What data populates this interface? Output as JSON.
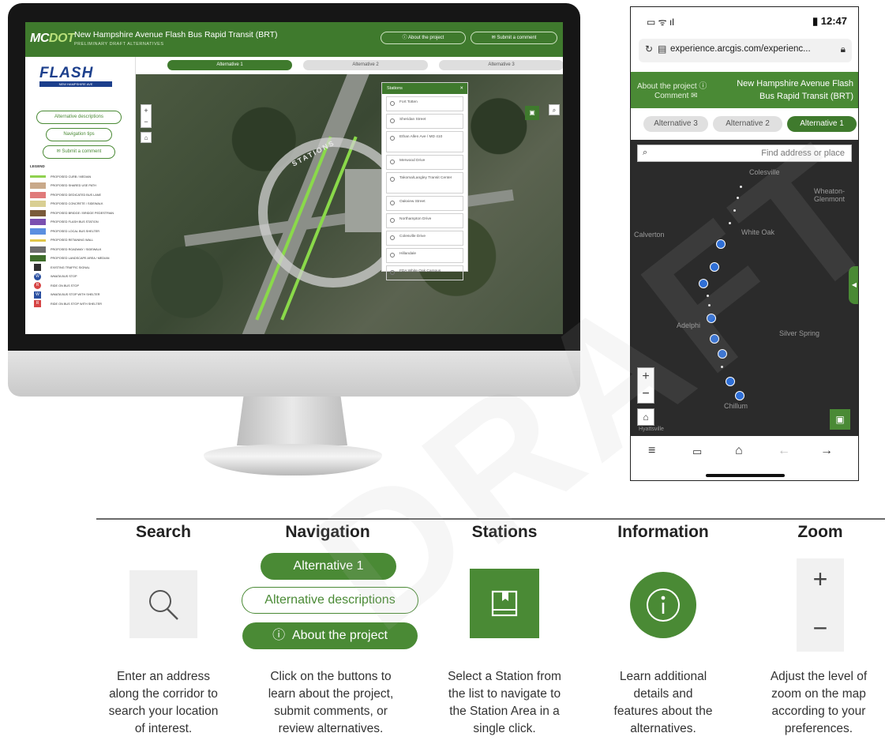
{
  "desktop": {
    "logo": {
      "main": "MC",
      "accent": "DOT"
    },
    "title": "New Hampshire Avenue Flash Bus Rapid Transit (BRT)",
    "subtitle": "PRELIMINARY DRAFT ALTERNATIVES",
    "header_buttons": [
      "About the project",
      "Submit a comment"
    ],
    "flash_logo": "FLASH",
    "flash_tag": "NEW HAMPSHIRE AVE",
    "left_buttons": [
      "Alternative descriptions",
      "Navigation tips",
      "Submit a comment"
    ],
    "legend_title": "LEGEND",
    "legend": [
      {
        "label": "PROPOSED CURB / MEDIAN",
        "color": "#8fd14f",
        "kind": "line"
      },
      {
        "label": "PROPOSED SHARED USE PATH",
        "color": "#c9a98a",
        "kind": "box"
      },
      {
        "label": "PROPOSED DEDICATED BUS LANE",
        "color": "#e07a7a",
        "kind": "box"
      },
      {
        "label": "PROPOSED CONCRETE / SIDEWALK",
        "color": "#d9cf93",
        "kind": "box"
      },
      {
        "label": "PROPOSED BRIDGE / BRIDGE PEDESTRIAN",
        "color": "#7a5a3a",
        "kind": "box"
      },
      {
        "label": "PROPOSED FLASH BUS STATION",
        "color": "#7a4fb0",
        "kind": "box"
      },
      {
        "label": "PROPOSED LOCAL BUS SHELTER",
        "color": "#5b8fe0",
        "kind": "box"
      },
      {
        "label": "PROPOSED RETAINING WALL",
        "color": "#e0c64a",
        "kind": "line"
      },
      {
        "label": "PROPOSED ROADWAY / SIDEWALK",
        "color": "#6d6d6d",
        "kind": "box"
      },
      {
        "label": "PROPOSED LANDSCAPE AREA / MEDIAN",
        "color": "#3f6e2c",
        "kind": "box"
      },
      {
        "label": "EXISTING TRAFFIC SIGNAL",
        "color": "#2f2f2f",
        "kind": "sq"
      },
      {
        "label": "WMATA BUS STOP",
        "color": "#2a4fa0",
        "kind": "circle",
        "glyph": "W"
      },
      {
        "label": "RIDE ON BUS STOP",
        "color": "#d64545",
        "kind": "circle",
        "glyph": "R"
      },
      {
        "label": "WMATA BUS STOP WITH SHELTER",
        "color": "#2a4fa0",
        "kind": "sq",
        "glyph": "W"
      },
      {
        "label": "RIDE ON BUS STOP WITH SHELTER",
        "color": "#d64545",
        "kind": "sq",
        "glyph": "R"
      }
    ],
    "tabs": [
      "Alternative 1",
      "Alternative 2",
      "Alternative 3"
    ],
    "map_ring_text": "STATIONS",
    "stations_title": "Stations",
    "stations": [
      "Fort Totten",
      "Sheridan Street",
      "Ethan Allen Ave / MD 410",
      "Merwood Drive",
      "Takoma/Langley Transit Center",
      "Oakview Street",
      "Northampton Drive",
      "Colesville Drive",
      "Hillandale",
      "FDA White Oak Campus"
    ]
  },
  "mobile": {
    "time": "12:47",
    "signal": "▮",
    "url": "experience.arcgis.com/experienc...",
    "title_line1": "New Hampshire Avenue Flash",
    "title_line2": "Bus Rapid Transit (BRT)",
    "about": "About the project",
    "comment": "Comment",
    "tabs": [
      "Alternative 1",
      "Alternative 2",
      "Alternative 3"
    ],
    "search_placeholder": "Find address or place",
    "places": [
      "Colesville",
      "Wheaton-Glenmont",
      "White Oak",
      "Calverton",
      "Adelphi",
      "Silver Spring",
      "Chillum",
      "Hyattsville"
    ]
  },
  "legend_panel": {
    "columns": [
      {
        "title": "Search",
        "desc": [
          "Enter an address",
          "along the corridor to",
          "search your location",
          "of interest."
        ]
      },
      {
        "title": "Navigation",
        "desc": [
          "Click on the buttons to",
          "learn about the project,",
          "submit comments, or",
          "review alternatives."
        ]
      },
      {
        "title": "Stations",
        "desc": [
          "Select a Station from",
          "the list to navigate to",
          "the Station Area in a",
          "single click."
        ]
      },
      {
        "title": "Information",
        "desc": [
          "Learn additional",
          "details and",
          "features about the",
          "alternatives."
        ]
      },
      {
        "title": "Zoom",
        "desc": [
          "Adjust the level of",
          "zoom on the map",
          "according to your",
          "preferences."
        ]
      }
    ],
    "nav_buttons": [
      "Alternative 1",
      "Alternative descriptions",
      "About the project"
    ],
    "accent_color": "#4a8a35"
  },
  "watermark": "DRAFT"
}
